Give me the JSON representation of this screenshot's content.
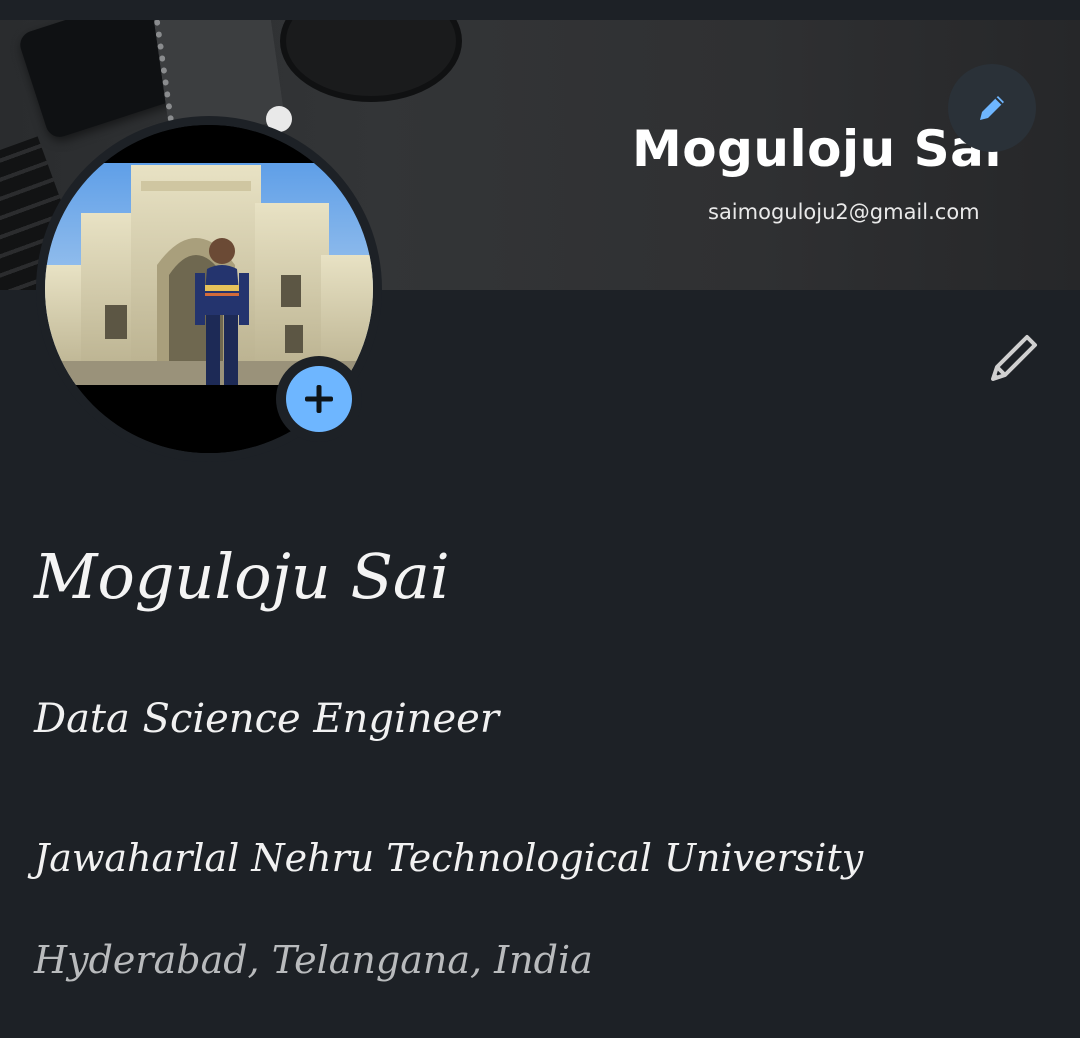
{
  "cover": {
    "name": "Moguloju Sai",
    "email": "saimoguloju2@gmail.com",
    "edit_icon": "pencil-icon"
  },
  "avatar": {
    "add_icon": "plus-icon",
    "add_color": "#6eb6ff"
  },
  "profile": {
    "edit_icon": "pencil-icon",
    "name": "Moguloju Sai",
    "title": "Data Science Engineer",
    "university": "Jawaharlal Nehru Technological University",
    "location": "Hyderabad, Telangana, India"
  },
  "colors": {
    "background": "#1d2126",
    "accent": "#6eb6ff"
  }
}
